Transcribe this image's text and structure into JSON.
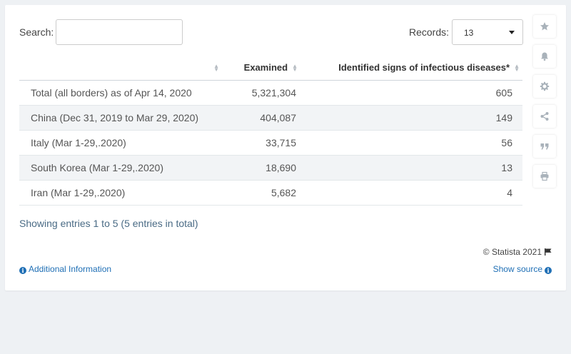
{
  "search": {
    "label": "Search:",
    "value": "",
    "placeholder": ""
  },
  "records": {
    "label": "Records:",
    "selected": "13"
  },
  "chart_data": {
    "type": "table",
    "columns": [
      "",
      "Examined",
      "Identified signs of infectious diseases*"
    ],
    "rows": [
      {
        "name": "Total (all borders) as of Apr 14, 2020",
        "examined": "5,321,304",
        "identified": "605"
      },
      {
        "name": "China (Dec 31, 2019 to Mar 29, 2020)",
        "examined": "404,087",
        "identified": "149"
      },
      {
        "name": "Italy (Mar 1-29,.2020)",
        "examined": "33,715",
        "identified": "56"
      },
      {
        "name": "South Korea (Mar 1-29,.2020)",
        "examined": "18,690",
        "identified": "13"
      },
      {
        "name": "Iran (Mar 1-29,.2020)",
        "examined": "5,682",
        "identified": "4"
      }
    ]
  },
  "footer": {
    "showing": "Showing entries 1 to 5 (5 entries in total)",
    "copyright": "© Statista 2021",
    "additional_info": "Additional Information",
    "show_source": "Show source"
  },
  "sidebar": {
    "icons": [
      "star-icon",
      "bell-icon",
      "gear-icon",
      "share-icon",
      "quote-icon",
      "print-icon"
    ]
  },
  "colors": {
    "link": "#1f6fb5",
    "stripe": "#f2f4f6",
    "icon": "#a9b2ba"
  }
}
